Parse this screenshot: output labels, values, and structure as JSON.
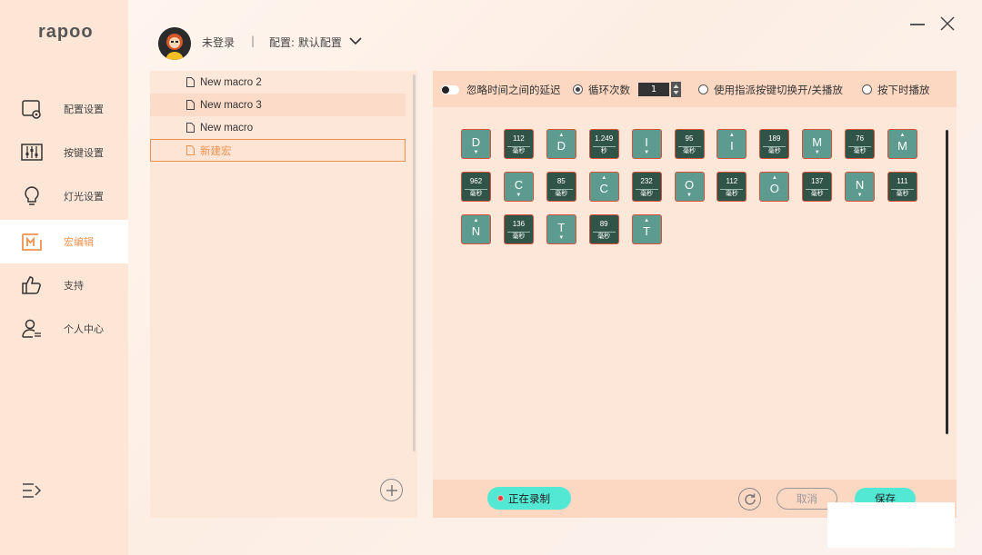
{
  "app": {
    "logo": "rapoo"
  },
  "sidebar": {
    "items": [
      {
        "label": "配置设置",
        "icon": "config-icon"
      },
      {
        "label": "按键设置",
        "icon": "key-settings-icon"
      },
      {
        "label": "灯光设置",
        "icon": "lightbulb-icon"
      },
      {
        "label": "宏编辑",
        "icon": "macro-icon",
        "active": true
      },
      {
        "label": "支持",
        "icon": "thumbs-up-icon"
      },
      {
        "label": "个人中心",
        "icon": "user-icon"
      }
    ]
  },
  "header": {
    "login_status": "未登录",
    "separator": "|",
    "config_label": "配置: 默认配置"
  },
  "macro_list": {
    "items": [
      {
        "name": "New macro 2"
      },
      {
        "name": "New macro 3"
      },
      {
        "name": "New macro"
      },
      {
        "name": "新建宏",
        "selected": true
      }
    ]
  },
  "options": {
    "ignore_delay": "忽略时间之间的延迟",
    "loop_count_label": "循环次数",
    "loop_count_value": "1",
    "toggle_mode": "使用指派按键切换开/关播放",
    "hold_mode": "按下时播放"
  },
  "sequence": [
    {
      "type": "key",
      "label": "D",
      "dir": "down"
    },
    {
      "type": "delay",
      "value": "112",
      "unit": "毫秒"
    },
    {
      "type": "key",
      "label": "D",
      "dir": "up"
    },
    {
      "type": "delay",
      "value": "1.249",
      "unit": "秒"
    },
    {
      "type": "key",
      "label": "I",
      "dir": "down"
    },
    {
      "type": "delay",
      "value": "95",
      "unit": "毫秒"
    },
    {
      "type": "key",
      "label": "I",
      "dir": "up"
    },
    {
      "type": "delay",
      "value": "189",
      "unit": "毫秒"
    },
    {
      "type": "key",
      "label": "M",
      "dir": "down"
    },
    {
      "type": "delay",
      "value": "76",
      "unit": "毫秒"
    },
    {
      "type": "key",
      "label": "M",
      "dir": "up"
    },
    {
      "type": "delay",
      "value": "962",
      "unit": "毫秒"
    },
    {
      "type": "key",
      "label": "C",
      "dir": "down"
    },
    {
      "type": "delay",
      "value": "85",
      "unit": "毫秒"
    },
    {
      "type": "key",
      "label": "C",
      "dir": "up"
    },
    {
      "type": "delay",
      "value": "232",
      "unit": "毫秒"
    },
    {
      "type": "key",
      "label": "O",
      "dir": "down"
    },
    {
      "type": "delay",
      "value": "112",
      "unit": "毫秒"
    },
    {
      "type": "key",
      "label": "O",
      "dir": "up"
    },
    {
      "type": "delay",
      "value": "137",
      "unit": "毫秒"
    },
    {
      "type": "key",
      "label": "N",
      "dir": "down"
    },
    {
      "type": "delay",
      "value": "111",
      "unit": "毫秒"
    },
    {
      "type": "key",
      "label": "N",
      "dir": "up"
    },
    {
      "type": "delay",
      "value": "136",
      "unit": "毫秒"
    },
    {
      "type": "key",
      "label": "T",
      "dir": "down"
    },
    {
      "type": "delay",
      "value": "89",
      "unit": "毫秒"
    },
    {
      "type": "key",
      "label": "T",
      "dir": "up"
    }
  ],
  "footer": {
    "recording": "正在录制",
    "cancel": "取消",
    "save": "保存"
  },
  "colors": {
    "accent": "#f0924e",
    "key_tile": "#5c9b8d",
    "delay_tile": "#315449",
    "teal_button": "#53e8d4"
  }
}
